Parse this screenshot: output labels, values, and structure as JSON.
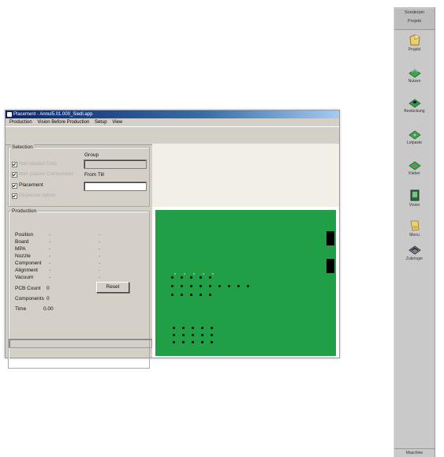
{
  "window": {
    "title": "Placement - Annul5.01.000_Siedl.app",
    "menu": [
      "Production",
      "Vision Before Production",
      "Setup",
      "View"
    ]
  },
  "selection": {
    "title": "Selection",
    "group_label": "Group",
    "from_till_label": "From Till",
    "checkboxes": [
      {
        "label": "Non placed Dots",
        "checked": true,
        "enabled": false
      },
      {
        "label": "Non placed Component",
        "checked": true,
        "enabled": false
      },
      {
        "label": "Placement",
        "checked": true,
        "enabled": true
      },
      {
        "label": "Dispense option",
        "checked": true,
        "enabled": false
      }
    ]
  },
  "production": {
    "title": "Production",
    "rows": [
      {
        "label": "Position",
        "v1": "-",
        "v2": "-"
      },
      {
        "label": "Board",
        "v1": "-",
        "v2": "-"
      },
      {
        "label": "MPA",
        "v1": "-",
        "v2": "-"
      },
      {
        "label": "Nozzle",
        "v1": "-",
        "v2": "-"
      },
      {
        "label": "Component",
        "v1": "-",
        "v2": "-"
      },
      {
        "label": "Alignment",
        "v1": "-",
        "v2": "-"
      },
      {
        "label": "Vacuum",
        "v1": "-",
        "v2": "-"
      }
    ],
    "pcb_count_label": "PCB Count",
    "pcb_count_value": "0",
    "reset_label": "Reset",
    "components_label": "Components",
    "components_value": "0",
    "time_label": "Time",
    "time_value": "0.00"
  },
  "toolbar": {
    "header": [
      "Sonderpin",
      "Projekt"
    ],
    "items": [
      {
        "label": "Projekt",
        "icon": "project-icon"
      },
      {
        "label": "Nutzen",
        "icon": "panel-icon"
      },
      {
        "label": "Bestückung",
        "icon": "assembly-icon"
      },
      {
        "label": "Lotpaste",
        "icon": "solder-paste-icon"
      },
      {
        "label": "Kleber",
        "icon": "adhesive-icon"
      },
      {
        "label": "Vision",
        "icon": "vision-icon"
      },
      {
        "label": "Menu",
        "icon": "menu-icon"
      },
      {
        "label": "Zubringer",
        "icon": "feeder-icon"
      }
    ],
    "footer": "Maschine"
  },
  "colors": {
    "board": "#219f46",
    "titlebar": "#0a246a",
    "window_bg": "#d4d0c8"
  }
}
